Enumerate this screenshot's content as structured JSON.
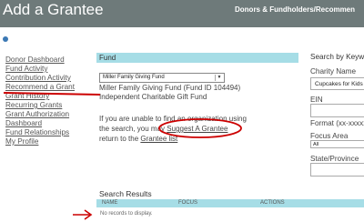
{
  "header": {
    "title": "Add a Grantee",
    "breadcrumb": "Donors & Fundholders/Recommen"
  },
  "sidebar": {
    "items": [
      {
        "label": "Donor Dashboard"
      },
      {
        "label": "Fund Activity"
      },
      {
        "label": "Contribution Activity"
      },
      {
        "label": "Recommend a Grant"
      },
      {
        "label": "Grant History"
      },
      {
        "label": "Recurring Grants"
      },
      {
        "label": "Grant Authorization"
      },
      {
        "label": "Dashboard"
      },
      {
        "label": "Fund Relationships"
      },
      {
        "label": "My Profile"
      }
    ]
  },
  "fund": {
    "section_title": "Fund",
    "selected_fund": "Miller Family Giving Fund",
    "fund_name_line": "Miller Family Giving Fund (Fund ID 104494)",
    "fund_type": "Independent Charitable Gift Fund",
    "help_line1": "If you are unable to find an organization using",
    "help_line2_pre": "the search, you may",
    "suggest_link": "Suggest A Grantee",
    "help_line3_pre": "return to the",
    "grantee_link": "Grantee list"
  },
  "search": {
    "title": "Search by Keywo",
    "charity_label": "Charity Name",
    "charity_value": "Cupcakes for Kids",
    "ein_label": "EIN",
    "format_label": "Format (xx-xxxxx",
    "focus_label": "Focus Area",
    "focus_value": "All",
    "state_label": "State/Province"
  },
  "results": {
    "title": "Search Results",
    "columns": [
      "NAME",
      "FOCUS",
      "ACTIONS"
    ],
    "empty_message": "No records to display."
  },
  "colors": {
    "header_bar": "#6e7a7a",
    "section_header": "#a6dde6",
    "annotation": "#cc0000"
  }
}
